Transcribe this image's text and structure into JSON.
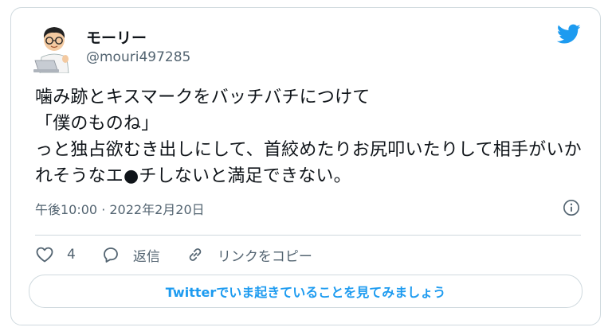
{
  "author": {
    "display_name": "モーリー",
    "handle": "@mouri497285"
  },
  "tweet": {
    "text": "噛み跡とキスマークをバッチバチにつけて\n「僕のものね」\nっと独占欲むき出しにして、首絞めたりお尻叩いたりして相手がいかれそうなエ●チしないと満足できない。"
  },
  "meta": {
    "timestamp": "午後10:00 · 2022年2月20日"
  },
  "actions": {
    "like_count": "4",
    "reply_label": "返信",
    "copy_link_label": "リンクをコピー"
  },
  "cta": {
    "label": "Twitterでいま起きていることを見てみましょう"
  },
  "colors": {
    "accent": "#1d9bf0",
    "secondary_text": "#536471",
    "border": "#cfd9de"
  },
  "icons": [
    "avatar-illustration",
    "twitter-bird-icon",
    "info-icon",
    "heart-icon",
    "reply-icon",
    "link-icon"
  ]
}
